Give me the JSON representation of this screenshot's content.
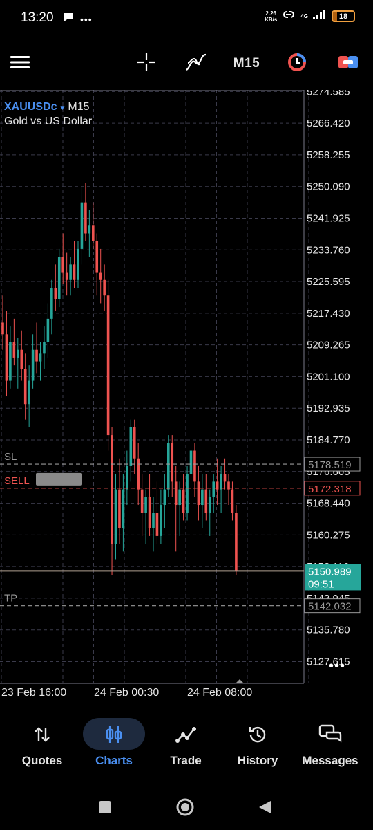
{
  "status": {
    "time": "13:20",
    "net_speed_value": "2.26",
    "net_speed_unit": "KB/s",
    "network": "4G",
    "battery": "18"
  },
  "toolbar": {
    "timeframe": "M15"
  },
  "chart": {
    "symbol": "XAUUSDc",
    "timeframe": "M15",
    "description": "Gold vs US Dollar",
    "more": "•••",
    "colors": {
      "up": "#26a69a",
      "down": "#ef5350",
      "grid": "#3a3a4a",
      "sell": "#ef5350",
      "sltp": "#9a9a9a",
      "bid": "#26a69a",
      "text": "#e6e6e6"
    }
  },
  "chart_data": {
    "type": "candlestick",
    "symbol": "XAUUSDc",
    "timeframe": "M15",
    "ylim": [
      5122,
      5275
    ],
    "price_ticks": [
      "5274.585",
      "5266.420",
      "5258.255",
      "5250.090",
      "5241.925",
      "5233.760",
      "5225.595",
      "5217.430",
      "5209.265",
      "5201.100",
      "5192.935",
      "5184.770",
      "5176.605",
      "5168.440",
      "5160.275",
      "5152.110",
      "5143.945",
      "5135.780",
      "5127.615"
    ],
    "time_labels": [
      "23 Feb 16:00",
      "24 Feb 00:30",
      "24 Feb 08:00"
    ],
    "levels": {
      "sl": {
        "label": "SL",
        "price": 5178.519,
        "text": "5178.519"
      },
      "sell": {
        "label": "SELL",
        "price": 5172.318,
        "text": "5172.318"
      },
      "tp": {
        "label": "TP",
        "price": 5142.032,
        "text": "5142.032"
      },
      "bid": {
        "price": 5150.989,
        "text": "5150.989",
        "countdown": "09:51"
      }
    },
    "candles": [
      [
        5215,
        5222,
        5208,
        5212
      ],
      [
        5212,
        5218,
        5196,
        5200
      ],
      [
        5200,
        5214,
        5198,
        5210
      ],
      [
        5210,
        5216,
        5204,
        5206
      ],
      [
        5206,
        5211,
        5198,
        5208
      ],
      [
        5208,
        5213,
        5200,
        5203
      ],
      [
        5203,
        5207,
        5190,
        5194
      ],
      [
        5194,
        5204,
        5188,
        5200
      ],
      [
        5200,
        5212,
        5198,
        5208
      ],
      [
        5208,
        5215,
        5202,
        5205
      ],
      [
        5205,
        5210,
        5200,
        5207
      ],
      [
        5207,
        5214,
        5203,
        5210
      ],
      [
        5210,
        5220,
        5206,
        5216
      ],
      [
        5216,
        5226,
        5212,
        5224
      ],
      [
        5224,
        5230,
        5218,
        5221
      ],
      [
        5221,
        5234,
        5219,
        5232
      ],
      [
        5232,
        5238,
        5225,
        5228
      ],
      [
        5228,
        5233,
        5222,
        5226
      ],
      [
        5226,
        5232,
        5222,
        5230
      ],
      [
        5230,
        5236,
        5224,
        5226
      ],
      [
        5226,
        5236,
        5224,
        5234
      ],
      [
        5234,
        5250,
        5230,
        5246
      ],
      [
        5246,
        5251,
        5236,
        5238
      ],
      [
        5238,
        5244,
        5232,
        5240
      ],
      [
        5240,
        5246,
        5234,
        5236
      ],
      [
        5236,
        5238,
        5222,
        5228
      ],
      [
        5228,
        5234,
        5220,
        5226
      ],
      [
        5226,
        5230,
        5218,
        5222
      ],
      [
        5222,
        5226,
        5182,
        5186
      ],
      [
        5186,
        5188,
        5150,
        5158
      ],
      [
        5158,
        5176,
        5154,
        5172
      ],
      [
        5172,
        5180,
        5158,
        5162
      ],
      [
        5162,
        5176,
        5156,
        5172
      ],
      [
        5172,
        5182,
        5168,
        5178
      ],
      [
        5178,
        5190,
        5174,
        5188
      ],
      [
        5188,
        5190,
        5176,
        5180
      ],
      [
        5180,
        5184,
        5168,
        5172
      ],
      [
        5172,
        5176,
        5160,
        5166
      ],
      [
        5166,
        5172,
        5158,
        5170
      ],
      [
        5170,
        5176,
        5160,
        5162
      ],
      [
        5162,
        5170,
        5156,
        5166
      ],
      [
        5166,
        5174,
        5158,
        5160
      ],
      [
        5160,
        5172,
        5158,
        5168
      ],
      [
        5168,
        5176,
        5162,
        5172
      ],
      [
        5172,
        5186,
        5170,
        5184
      ],
      [
        5184,
        5186,
        5170,
        5174
      ],
      [
        5174,
        5178,
        5156,
        5168
      ],
      [
        5168,
        5174,
        5160,
        5172
      ],
      [
        5172,
        5176,
        5164,
        5166
      ],
      [
        5166,
        5178,
        5164,
        5176
      ],
      [
        5176,
        5184,
        5172,
        5182
      ],
      [
        5182,
        5184,
        5170,
        5174
      ],
      [
        5174,
        5178,
        5164,
        5168
      ],
      [
        5168,
        5176,
        5162,
        5172
      ],
      [
        5172,
        5176,
        5164,
        5166
      ],
      [
        5166,
        5172,
        5160,
        5170
      ],
      [
        5170,
        5176,
        5166,
        5174
      ],
      [
        5174,
        5180,
        5168,
        5172
      ],
      [
        5172,
        5178,
        5166,
        5176
      ],
      [
        5176,
        5180,
        5172,
        5174
      ],
      [
        5174,
        5176,
        5168,
        5172
      ],
      [
        5172,
        5174,
        5164,
        5166
      ],
      [
        5166,
        5168,
        5150,
        5151
      ]
    ]
  },
  "nav": {
    "quotes": "Quotes",
    "charts": "Charts",
    "trade": "Trade",
    "history": "History",
    "messages": "Messages"
  }
}
